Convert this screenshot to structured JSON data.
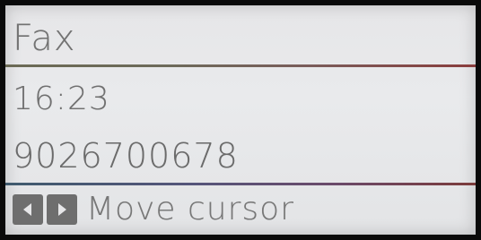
{
  "screen": {
    "title": "Fax",
    "time": "16:23",
    "number": "9026700678"
  },
  "hint": {
    "icons": [
      "left-arrow-key-icon",
      "right-arrow-key-icon"
    ],
    "label": "Move cursor"
  },
  "colors": {
    "background": "#e6e6e8",
    "text": "#6f6f6f",
    "separator_top": "#7a5c5a",
    "separator_bottom": "#55557a"
  }
}
